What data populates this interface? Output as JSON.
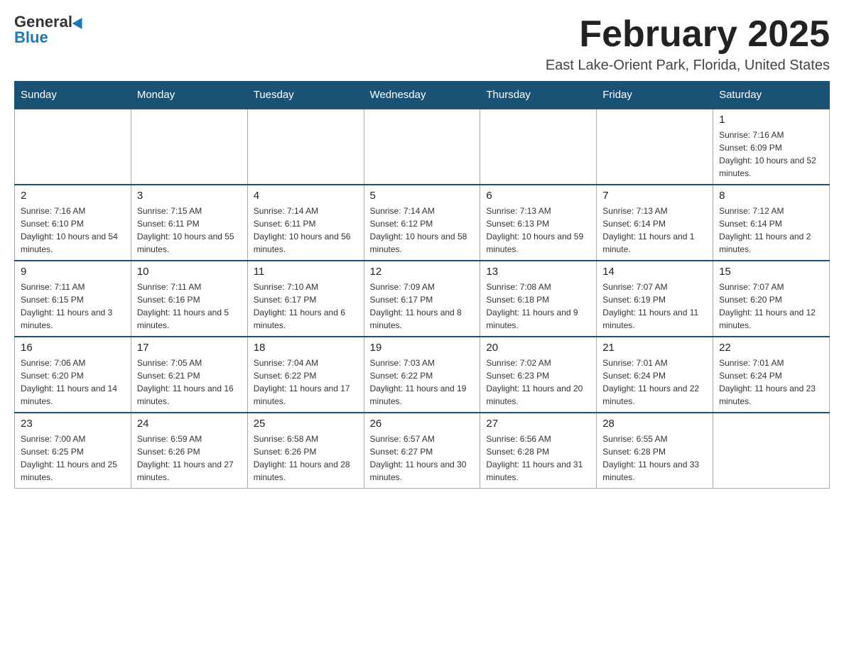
{
  "logo": {
    "general": "General",
    "blue": "Blue"
  },
  "header": {
    "title": "February 2025",
    "subtitle": "East Lake-Orient Park, Florida, United States"
  },
  "weekdays": [
    "Sunday",
    "Monday",
    "Tuesday",
    "Wednesday",
    "Thursday",
    "Friday",
    "Saturday"
  ],
  "weeks": [
    [
      {
        "day": "",
        "info": ""
      },
      {
        "day": "",
        "info": ""
      },
      {
        "day": "",
        "info": ""
      },
      {
        "day": "",
        "info": ""
      },
      {
        "day": "",
        "info": ""
      },
      {
        "day": "",
        "info": ""
      },
      {
        "day": "1",
        "info": "Sunrise: 7:16 AM\nSunset: 6:09 PM\nDaylight: 10 hours and 52 minutes."
      }
    ],
    [
      {
        "day": "2",
        "info": "Sunrise: 7:16 AM\nSunset: 6:10 PM\nDaylight: 10 hours and 54 minutes."
      },
      {
        "day": "3",
        "info": "Sunrise: 7:15 AM\nSunset: 6:11 PM\nDaylight: 10 hours and 55 minutes."
      },
      {
        "day": "4",
        "info": "Sunrise: 7:14 AM\nSunset: 6:11 PM\nDaylight: 10 hours and 56 minutes."
      },
      {
        "day": "5",
        "info": "Sunrise: 7:14 AM\nSunset: 6:12 PM\nDaylight: 10 hours and 58 minutes."
      },
      {
        "day": "6",
        "info": "Sunrise: 7:13 AM\nSunset: 6:13 PM\nDaylight: 10 hours and 59 minutes."
      },
      {
        "day": "7",
        "info": "Sunrise: 7:13 AM\nSunset: 6:14 PM\nDaylight: 11 hours and 1 minute."
      },
      {
        "day": "8",
        "info": "Sunrise: 7:12 AM\nSunset: 6:14 PM\nDaylight: 11 hours and 2 minutes."
      }
    ],
    [
      {
        "day": "9",
        "info": "Sunrise: 7:11 AM\nSunset: 6:15 PM\nDaylight: 11 hours and 3 minutes."
      },
      {
        "day": "10",
        "info": "Sunrise: 7:11 AM\nSunset: 6:16 PM\nDaylight: 11 hours and 5 minutes."
      },
      {
        "day": "11",
        "info": "Sunrise: 7:10 AM\nSunset: 6:17 PM\nDaylight: 11 hours and 6 minutes."
      },
      {
        "day": "12",
        "info": "Sunrise: 7:09 AM\nSunset: 6:17 PM\nDaylight: 11 hours and 8 minutes."
      },
      {
        "day": "13",
        "info": "Sunrise: 7:08 AM\nSunset: 6:18 PM\nDaylight: 11 hours and 9 minutes."
      },
      {
        "day": "14",
        "info": "Sunrise: 7:07 AM\nSunset: 6:19 PM\nDaylight: 11 hours and 11 minutes."
      },
      {
        "day": "15",
        "info": "Sunrise: 7:07 AM\nSunset: 6:20 PM\nDaylight: 11 hours and 12 minutes."
      }
    ],
    [
      {
        "day": "16",
        "info": "Sunrise: 7:06 AM\nSunset: 6:20 PM\nDaylight: 11 hours and 14 minutes."
      },
      {
        "day": "17",
        "info": "Sunrise: 7:05 AM\nSunset: 6:21 PM\nDaylight: 11 hours and 16 minutes."
      },
      {
        "day": "18",
        "info": "Sunrise: 7:04 AM\nSunset: 6:22 PM\nDaylight: 11 hours and 17 minutes."
      },
      {
        "day": "19",
        "info": "Sunrise: 7:03 AM\nSunset: 6:22 PM\nDaylight: 11 hours and 19 minutes."
      },
      {
        "day": "20",
        "info": "Sunrise: 7:02 AM\nSunset: 6:23 PM\nDaylight: 11 hours and 20 minutes."
      },
      {
        "day": "21",
        "info": "Sunrise: 7:01 AM\nSunset: 6:24 PM\nDaylight: 11 hours and 22 minutes."
      },
      {
        "day": "22",
        "info": "Sunrise: 7:01 AM\nSunset: 6:24 PM\nDaylight: 11 hours and 23 minutes."
      }
    ],
    [
      {
        "day": "23",
        "info": "Sunrise: 7:00 AM\nSunset: 6:25 PM\nDaylight: 11 hours and 25 minutes."
      },
      {
        "day": "24",
        "info": "Sunrise: 6:59 AM\nSunset: 6:26 PM\nDaylight: 11 hours and 27 minutes."
      },
      {
        "day": "25",
        "info": "Sunrise: 6:58 AM\nSunset: 6:26 PM\nDaylight: 11 hours and 28 minutes."
      },
      {
        "day": "26",
        "info": "Sunrise: 6:57 AM\nSunset: 6:27 PM\nDaylight: 11 hours and 30 minutes."
      },
      {
        "day": "27",
        "info": "Sunrise: 6:56 AM\nSunset: 6:28 PM\nDaylight: 11 hours and 31 minutes."
      },
      {
        "day": "28",
        "info": "Sunrise: 6:55 AM\nSunset: 6:28 PM\nDaylight: 11 hours and 33 minutes."
      },
      {
        "day": "",
        "info": ""
      }
    ]
  ]
}
